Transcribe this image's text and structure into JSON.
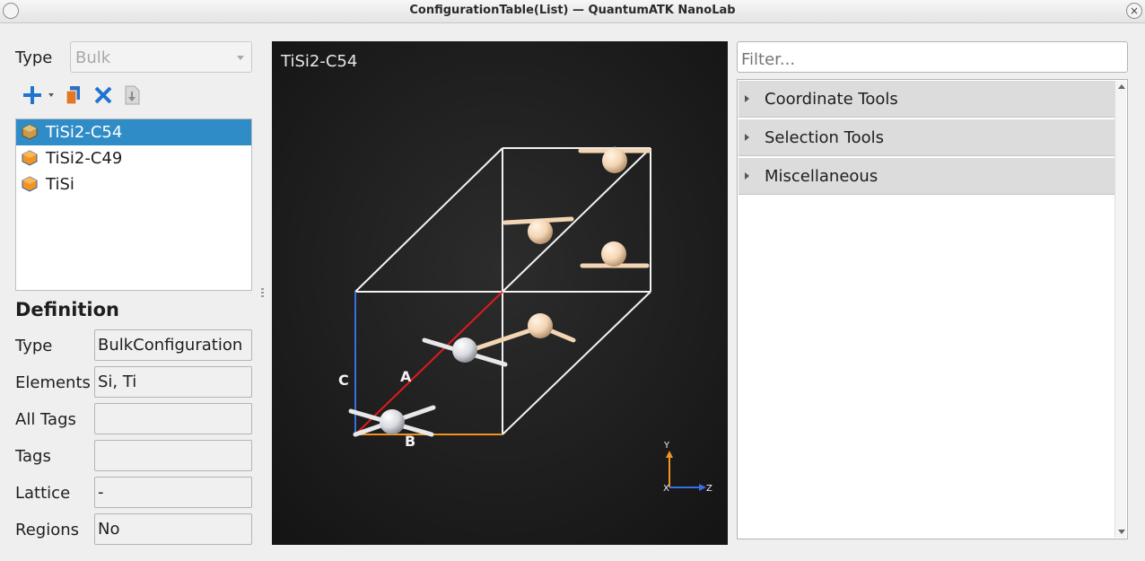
{
  "window": {
    "title": "ConfigurationTable(List) — QuantumATK NanoLab",
    "close_glyph": "×"
  },
  "type_row": {
    "label": "Type",
    "value": "Bulk"
  },
  "toolbar": {
    "add": "plus-icon",
    "copy": "copy-icon",
    "delete": "delete-icon",
    "import": "import-icon"
  },
  "configurations": [
    {
      "name": "TiSi2-C54",
      "selected": true
    },
    {
      "name": "TiSi2-C49",
      "selected": false
    },
    {
      "name": "TiSi",
      "selected": false
    }
  ],
  "definition": {
    "title": "Definition",
    "rows": [
      {
        "label": "Type",
        "value": "BulkConfiguration"
      },
      {
        "label": "Elements",
        "value": "Si, Ti"
      },
      {
        "label": "All Tags",
        "value": ""
      },
      {
        "label": "Tags",
        "value": ""
      },
      {
        "label": "Lattice",
        "value": "-"
      },
      {
        "label": "Regions",
        "value": "No"
      }
    ]
  },
  "viewer": {
    "title": "TiSi2-C54",
    "lattice_labels": {
      "a": "A",
      "b": "B",
      "c": "C"
    },
    "axes": {
      "y": "Y",
      "x": "X",
      "z": "Z"
    },
    "colors": {
      "a": "#e01b1b",
      "b": "#f29422",
      "c": "#3a6fe0",
      "ti": "#f3d5b3",
      "si": "#e8eaee"
    }
  },
  "filter": {
    "placeholder": "Filter..."
  },
  "tool_sections": [
    "Coordinate Tools",
    "Selection Tools",
    "Miscellaneous"
  ]
}
